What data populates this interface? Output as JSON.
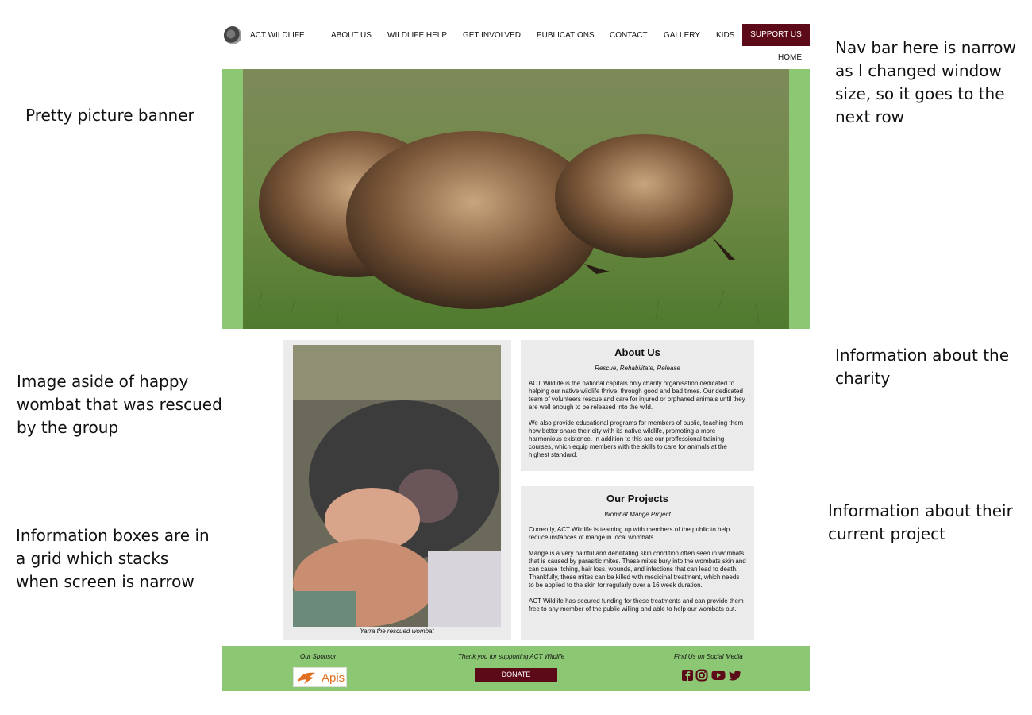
{
  "annotations": {
    "banner": "Pretty picture banner",
    "nav": "Nav bar here is narrow\nas I changed window\nsize, so it goes to the\nnext row",
    "aside": "Image aside of happy\nwombat that was rescued\nby the group",
    "charity": "Information about the\ncharity",
    "grid": "Information boxes are in\na grid which stacks\nwhen screen is narrow",
    "project": "Information about their\ncurrent project"
  },
  "nav": {
    "brand": "ACT WILDLIFE",
    "links": [
      "ABOUT US",
      "WILDLIFE HELP",
      "GET INVOLVED",
      "PUBLICATIONS",
      "CONTACT",
      "GALLERY",
      "KIDS",
      "HOME"
    ],
    "support": "SUPPORT US",
    "logo_icon": "echidna-logo-icon"
  },
  "aside": {
    "caption": "Yarra the rescued wombat"
  },
  "about": {
    "title": "About Us",
    "subtitle": "Rescue, Rehabilitate, Release",
    "p1": "ACT Wildlife is the national capitals only charity organisation dedicated to helping our native wildlife thrive, through good and bad times. Our dedicated team of volunteers rescue and care for injured or orphaned animals until they are well enough to be released into the wild.",
    "p2": "We also provide educational programs for members of public, teaching them how better share their city with its native wildlife, promoting a more harmonious existence. In addition to this are our proffessional training courses, which equip members with the skills to care for animals at the highest standard."
  },
  "projects": {
    "title": "Our Projects",
    "subtitle": "Wombat Mange Project",
    "p1": "Currently, ACT Wildlife is teaming up with members of the public to help reduce instances of mange in local wombats.",
    "p2": "Mange is a very painful and debilitating skin condition often seen in wombats that is caused by parasitic mites. These mites bury into the wombats skin and can cause itching, hair loss, wounds, and infections that can lead to death. Thankfully, these mites can be killed with medicinal treatment, which needs to be applied to the skin for regularly over a 16 week duration.",
    "p3": "ACT Wildlife has secured funding for these treatments and can provide them free to any member of the public willing and able to help our wombats out."
  },
  "footer": {
    "sponsor_label": "Our Sponsor",
    "sponsor_name": "Apis",
    "thanks": "Thank you for supporting ACT Wildlife",
    "donate": "DONATE",
    "social_label": "Find Us on Social Media",
    "social_icons": [
      "facebook-icon",
      "instagram-icon",
      "youtube-icon",
      "twitter-icon"
    ]
  },
  "colors": {
    "nav_accent": "#5c0a18",
    "green": "#8cc874",
    "card_bg": "#ebebeb",
    "sponsor_orange": "#e07020"
  }
}
